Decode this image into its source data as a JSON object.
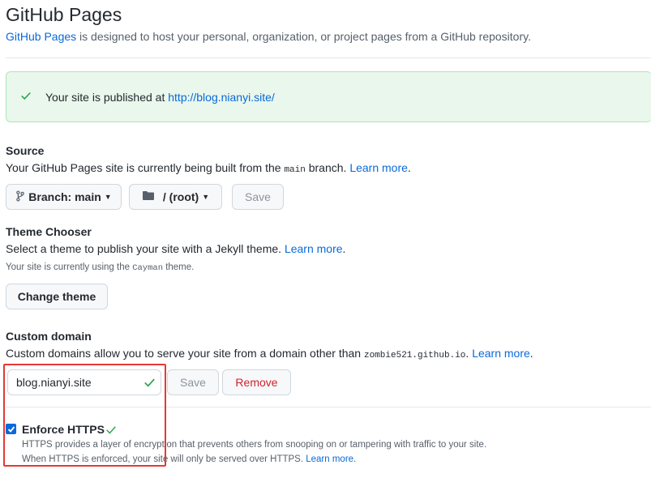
{
  "header": {
    "title": "GitHub Pages",
    "subtitle_link": "GitHub Pages",
    "subtitle_rest": " is designed to host your personal, organization, or project pages from a GitHub repository."
  },
  "flash": {
    "text": "Your site is published at ",
    "url": "http://blog.nianyi.site/"
  },
  "source": {
    "title": "Source",
    "desc_before": "Your GitHub Pages site is currently being built from the ",
    "branch_code": "main",
    "desc_after": " branch. ",
    "learn_more": "Learn more",
    "branch_button": "Branch: main",
    "folder_button": "/ (root)",
    "save_button": "Save"
  },
  "theme": {
    "title": "Theme Chooser",
    "desc": "Select a theme to publish your site with a Jekyll theme. ",
    "learn_more": "Learn more",
    "note_before": "Your site is currently using the ",
    "note_theme": "Cayman",
    "note_after": " theme.",
    "change_button": "Change theme"
  },
  "custom_domain": {
    "title": "Custom domain",
    "desc_before": "Custom domains allow you to serve your site from a domain other than ",
    "domain_code": "zombie521.github.io",
    "desc_after": ". ",
    "learn_more": "Learn more",
    "input_value": "blog.nianyi.site",
    "save_button": "Save",
    "remove_button": "Remove"
  },
  "https": {
    "label": "Enforce HTTPS",
    "checked": true,
    "line1": "HTTPS provides a layer of encryption that prevents others from snooping on or tampering with traffic to your site.",
    "line2": "When HTTPS is enforced, your site will only be served over HTTPS. ",
    "learn_more": "Learn more",
    "line2_end": "."
  },
  "colors": {
    "accent": "#0969da",
    "success": "#2da44e",
    "danger": "#cf222e",
    "highlight": "#e53935"
  }
}
